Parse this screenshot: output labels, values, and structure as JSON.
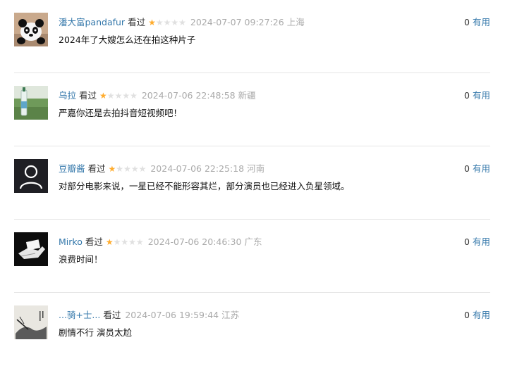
{
  "comments": [
    {
      "user": "潘大富pandafur",
      "watched_label": "看过",
      "rating": 1,
      "time": "2024-07-07 09:27:26",
      "location": "上海",
      "text": "2024年了大嫂怎么还在拍这种片子",
      "votes": "0",
      "useful_label": "有用",
      "avatar_icon": "panda-avatar"
    },
    {
      "user": "乌拉",
      "watched_label": "看过",
      "rating": 1,
      "time": "2024-07-06 22:48:58",
      "location": "新疆",
      "text": "严嘉你还是去拍抖音短视频吧！",
      "votes": "0",
      "useful_label": "有用",
      "avatar_icon": "bottle-landscape-avatar"
    },
    {
      "user": "豆瓣酱",
      "watched_label": "看过",
      "rating": 1,
      "time": "2024-07-06 22:25:18",
      "location": "河南",
      "text": "对部分电影来说，一星已经不能形容其烂，部分演员也已经进入负星领域。",
      "votes": "0",
      "useful_label": "有用",
      "avatar_icon": "default-user-avatar"
    },
    {
      "user": "Mirko",
      "watched_label": "看过",
      "rating": 1,
      "time": "2024-07-06 20:46:30",
      "location": "广东",
      "text": "浪费时间！",
      "votes": "0",
      "useful_label": "有用",
      "avatar_icon": "hand-card-avatar"
    },
    {
      "user": "...骑+士...",
      "watched_label": "看过",
      "rating": 0,
      "time": "2024-07-06 19:59:44",
      "location": "江苏",
      "text": "剧情不行 演员太尬",
      "votes": "0",
      "useful_label": "有用",
      "avatar_icon": "ink-painting-avatar"
    }
  ],
  "colors": {
    "link": "#3377aa",
    "star_on": "#ffac2d",
    "star_off": "#e0e0e0",
    "muted": "#aaaaaa"
  }
}
